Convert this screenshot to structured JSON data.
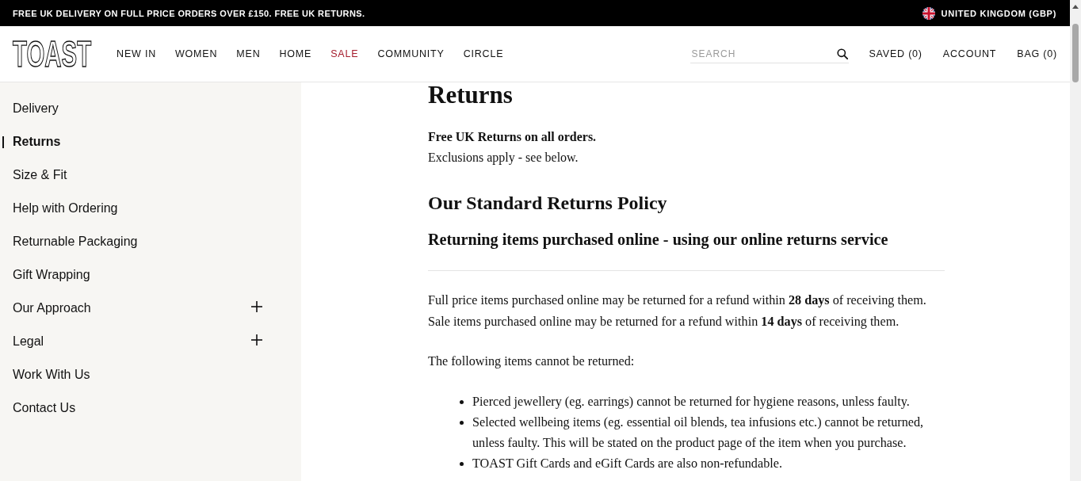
{
  "promo_bar": {
    "message": "FREE UK DELIVERY ON FULL PRICE ORDERS OVER £150. FREE UK RETURNS.",
    "region": "UNITED KINGDOM (GBP)"
  },
  "header": {
    "logo": "TOAST",
    "nav": [
      {
        "label": "NEW IN",
        "kind": "standard"
      },
      {
        "label": "WOMEN",
        "kind": "standard"
      },
      {
        "label": "MEN",
        "kind": "standard"
      },
      {
        "label": "HOME",
        "kind": "standard"
      },
      {
        "label": "SALE",
        "kind": "sale"
      },
      {
        "label": "COMMUNITY",
        "kind": "standard"
      },
      {
        "label": "CIRCLE",
        "kind": "standard"
      }
    ],
    "search": {
      "placeholder": "SEARCH"
    },
    "actions": [
      "SAVED (0)",
      "ACCOUNT",
      "BAG (0)"
    ]
  },
  "sidebar": {
    "items": [
      {
        "label": "Delivery",
        "kind": "link",
        "selected": false
      },
      {
        "label": "Returns",
        "kind": "link",
        "selected": true
      },
      {
        "label": "Size & Fit",
        "kind": "link",
        "selected": false
      },
      {
        "label": "Help with Ordering",
        "kind": "link",
        "selected": false
      },
      {
        "label": "Returnable Packaging",
        "kind": "link",
        "selected": false
      },
      {
        "label": "Gift Wrapping",
        "kind": "link",
        "selected": false
      },
      {
        "label": "Our Approach",
        "kind": "group",
        "selected": false,
        "expanded": false
      },
      {
        "label": "Legal",
        "kind": "group",
        "selected": false,
        "expanded": false
      },
      {
        "label": "Work With Us",
        "kind": "link",
        "selected": false
      },
      {
        "label": "Contact Us",
        "kind": "link",
        "selected": false
      }
    ]
  },
  "article": {
    "title": "Returns",
    "lead": "Free UK Returns on all orders.",
    "note": "Exclusions apply - see below.",
    "section_title": "Our Standard Returns Policy",
    "subsection_title": "Returning items purchased online - using our online returns service",
    "refund_lines": [
      "Full price items purchased online may be returned for a refund within **28 days** of receiving them.",
      "Sale items purchased online may be returned for a refund within **14 days** of receiving them."
    ],
    "exclusions_intro": "The following items cannot be returned:",
    "exclusions": [
      "Pierced jewellery (eg. earrings) cannot be returned for hygiene reasons, unless faulty.",
      "Selected wellbeing items (eg. essential oil blends, tea infusions etc.) cannot be returned, unless faulty. This will be stated on the product page of the item when you purchase.",
      "TOAST Gift Cards and eGift Cards are also non-refundable."
    ]
  }
}
